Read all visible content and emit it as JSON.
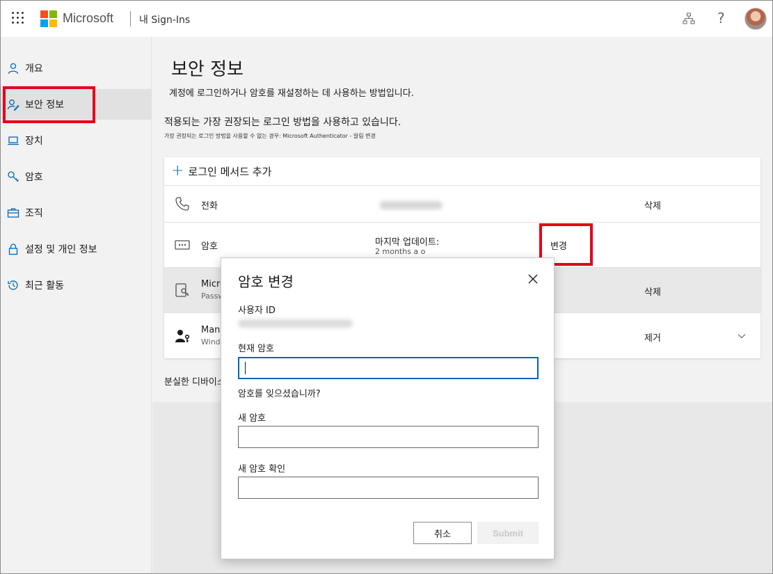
{
  "header": {
    "brand": "Microsoft",
    "app_title": "내 Sign-Ins",
    "help_glyph": "?",
    "logo_colors": [
      "#f25022",
      "#7fba00",
      "#00a4ef",
      "#ffb900"
    ]
  },
  "sidebar": {
    "items": [
      {
        "label": "개요",
        "icon": "person-icon"
      },
      {
        "label": "보안 정보",
        "icon": "security-info-icon",
        "active": true
      },
      {
        "label": "장치",
        "icon": "laptop-icon"
      },
      {
        "label": "암호",
        "icon": "key-icon"
      },
      {
        "label": "조직",
        "icon": "briefcase-icon"
      },
      {
        "label": "설정 및 개인 정보",
        "icon": "lock-icon"
      },
      {
        "label": "최근 활동",
        "icon": "history-icon"
      }
    ]
  },
  "main": {
    "title": "보안 정보",
    "subtitle": "계정에 로그인하거나 암호를 재설정하는 데 사용하는 방법입니다.",
    "default_method_line": "적용되는 가장 권장되는 로그인 방법을 사용하고 있습니다.",
    "default_method_small": "가장 권장되는 로그인 방법을 사용할 수 없는 경우: Microsoft Authenticator - 알림 변경",
    "add_method_label": "로그인 메서드 추가",
    "plus_glyph": "+",
    "methods": [
      {
        "name": "전화",
        "value": "",
        "action": "삭제",
        "icon": "phone-icon"
      },
      {
        "name": "암호",
        "value": "마지막 업데이트:",
        "value2": "2 months a o",
        "action": "변경",
        "icon": "password-icon"
      },
      {
        "name": "Micro",
        "name2": "Passw",
        "action": "삭제",
        "icon": "passwordless-icon"
      },
      {
        "name": "Mana",
        "name2": "Wind",
        "action": "제거",
        "icon": "user-key-icon"
      }
    ],
    "lost_device_link": "분실한 디바이스?"
  },
  "dialog": {
    "title": "암호 변경",
    "user_id_label": "사용자 ID",
    "current_password_label": "현재 암호",
    "forgot_password_link": "암호를 잊으셨습니까?",
    "new_password_label": "새 암호",
    "confirm_password_label": "새 암호 확인",
    "current_password_value": "",
    "new_password_value": "",
    "confirm_password_value": "",
    "cancel_label": "취소",
    "submit_label": "Submit"
  },
  "colors": {
    "accent": "#0067b8",
    "highlight_box": "#e3001b"
  }
}
